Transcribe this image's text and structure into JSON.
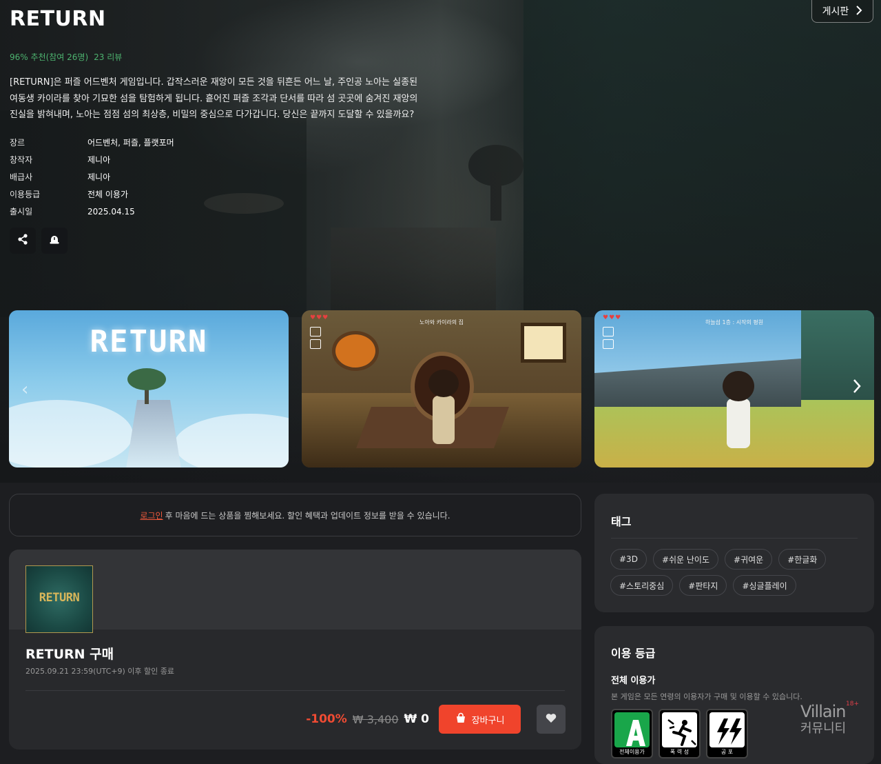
{
  "game": {
    "title": "RETURN",
    "recommend": "96% 추천(참여 26명)",
    "reviews": "23 리뷰",
    "description": "[RETURN]은 퍼즐 어드벤처 게임입니다. 갑작스러운 재앙이 모든 것을 뒤흔든 어느 날, 주인공 노아는 실종된 여동생 카이라를 찾아 기묘한 섬을 탐험하게 됩니다. 흩어진 퍼즐 조각과 단서를 따라 섬 곳곳에 숨겨진 재앙의 진실을 밝혀내며, 노아는 점점 섬의 최상층, 비밀의 중심으로 다가갑니다. 당신은 끝까지 도달할 수 있을까요?",
    "info": [
      {
        "label": "장르",
        "value": "어드벤처, 퍼즐, 플랫포머"
      },
      {
        "label": "창작자",
        "value": "제니아"
      },
      {
        "label": "배급사",
        "value": "제니아"
      },
      {
        "label": "이용등급",
        "value": "전체 이용가"
      },
      {
        "label": "출시일",
        "value": "2025.04.15"
      }
    ]
  },
  "header": {
    "board_label": "게시판"
  },
  "screenshots": [
    {
      "logo": "RETURN"
    },
    {
      "hud_title": "노아와 카이라의 집"
    },
    {
      "hud_title": "하늘섬 1층 : 시작의 평원"
    }
  ],
  "login_notice": {
    "link": "로그인",
    "text": "후 마음에 드는 상품을 찜해보세요. 할인 혜택과 업데이트 정보를 받을 수 있습니다."
  },
  "purchase": {
    "cover_text": "RETURN",
    "title": "RETURN 구매",
    "sale_end": "2025.09.21 23:59(UTC+9) 이후 할인 종료",
    "discount": "-100%",
    "original_price": "₩ 3,400",
    "final_price": "₩ 0",
    "cart_label": "장바구니"
  },
  "tags": {
    "heading": "태그",
    "items": [
      "#3D",
      "#쉬운 난이도",
      "#귀여운",
      "#한글화",
      "#스토리중심",
      "#판타지",
      "#싱글플레이"
    ]
  },
  "age_rating": {
    "heading": "이용 등급",
    "label": "전체 이용가",
    "description": "본 게임은 모든 연령의 이용자가 구매 및 이용할 수 있습니다.",
    "badges": [
      "전체이용가",
      "폭 력 성",
      "공  포"
    ]
  },
  "watermark": {
    "line1": "Villain",
    "line2": "커뮤니티",
    "age": "18+"
  },
  "colors": {
    "accent": "#f0442c",
    "recommend": "#4db36f",
    "link": "#f05a3c"
  }
}
